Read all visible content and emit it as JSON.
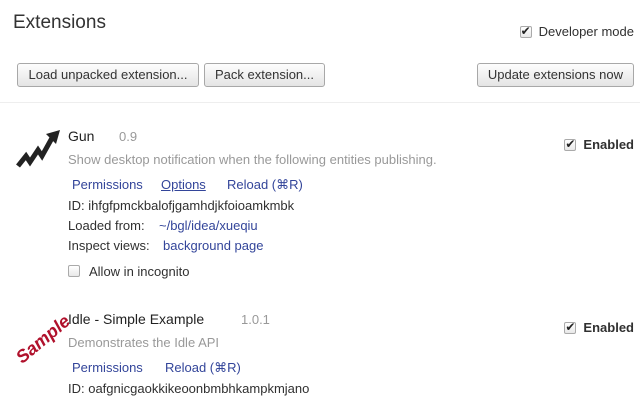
{
  "header": {
    "title": "Extensions",
    "developer_mode_label": "Developer mode",
    "developer_mode_checked": true
  },
  "toolbar": {
    "load_unpacked": "Load unpacked extension...",
    "pack": "Pack extension...",
    "update": "Update extensions now"
  },
  "extensions": [
    {
      "name": "Gun",
      "version": "0.9",
      "description": "Show desktop notification when the following entities publishing.",
      "links": {
        "permissions": "Permissions",
        "options": "Options",
        "reload": "Reload (⌘R)"
      },
      "id_label": "ID: ihfgfpmckbalofjgamhdjkfoioamkmbk",
      "loaded_from_label": "Loaded from:",
      "loaded_from": "~/bgl/idea/xueqiu",
      "inspect_label": "Inspect views:",
      "inspect_link": "background page",
      "incognito_label": "Allow in incognito",
      "enable_label": "Enabled",
      "enabled": true,
      "icon": "trending-up-arrow-icon"
    },
    {
      "name": "Idle - Simple Example",
      "version": "1.0.1",
      "description": "Demonstrates the Idle API",
      "links": {
        "permissions": "Permissions",
        "reload": "Reload (⌘R)"
      },
      "id_label": "ID: oafgnicgaokkikeoonbmbhkampkmjano",
      "enable_label": "Enabled",
      "enabled": true,
      "icon_text": "Sample"
    }
  ]
}
